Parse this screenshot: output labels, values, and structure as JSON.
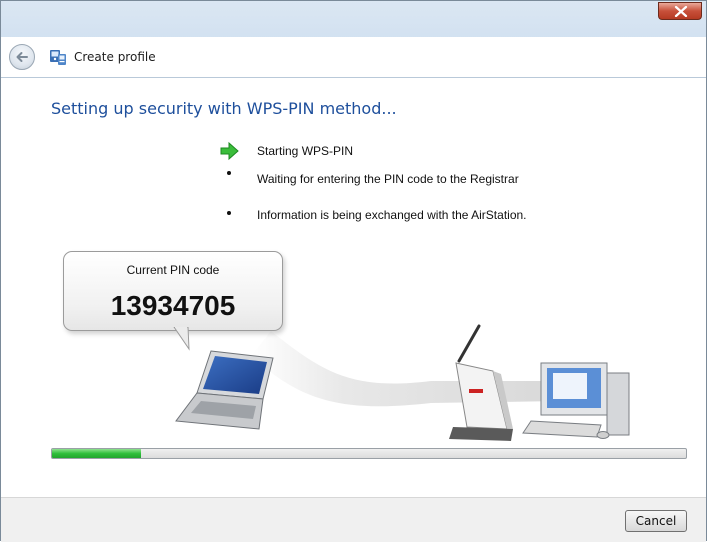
{
  "window": {
    "title": "Create profile",
    "icons": {
      "close": "close-icon",
      "back": "back-arrow-icon",
      "app": "network-profile-icon"
    }
  },
  "main": {
    "heading": "Setting up security with WPS-PIN method...",
    "steps": [
      {
        "label": "Starting WPS-PIN",
        "status": "current",
        "marker": "green-arrow-icon"
      },
      {
        "label": "Waiting for entering the PIN code to the Registrar",
        "status": "pending",
        "marker": "bullet"
      },
      {
        "label": "Information is being exchanged with the AirStation.",
        "status": "pending",
        "marker": "bullet"
      }
    ],
    "pin": {
      "label": "Current PIN code",
      "value": "13934705"
    },
    "progress": {
      "fraction": 0.14
    }
  },
  "footer": {
    "cancel_label": "Cancel"
  },
  "colors": {
    "heading": "#1e4f9c",
    "progress_green": "#2fbf3b",
    "close_red": "#c8503a"
  }
}
